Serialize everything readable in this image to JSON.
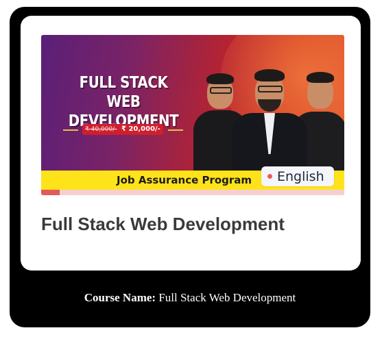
{
  "banner": {
    "title_line1": "FULL STACK",
    "title_line2": "WEB DEVELOPMENT",
    "price_old": "₹ 40,000/-",
    "price_new": "₹ 20,000/-",
    "program_text": "Job Assurance Program",
    "progress_fraction": 0.06
  },
  "badge": {
    "language": "English",
    "dot_color": "#ef5a5a"
  },
  "card": {
    "title": "Full Stack Web Development"
  },
  "caption": {
    "label": "Course Name:",
    "value": " Full Stack Web Development"
  },
  "colors": {
    "outer": "#000000",
    "inner": "#ffffff",
    "yellow": "#ffe31a"
  }
}
